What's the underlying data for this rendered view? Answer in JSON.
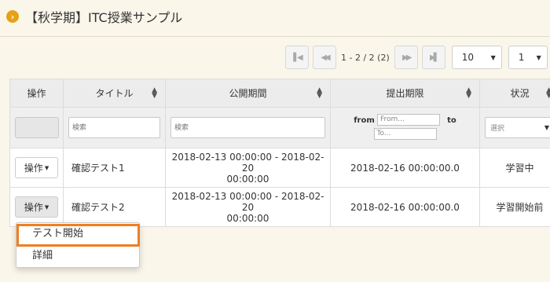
{
  "page": {
    "title": "【秋学期】ITC授業サンプル",
    "title_icon": "chevron-right-circle-icon"
  },
  "pager": {
    "info": "1 - 2 / 2 (2)",
    "per_page": "10",
    "page": "1"
  },
  "table": {
    "headers": {
      "operation": "操作",
      "title": "タイトル",
      "period": "公開期間",
      "deadline": "提出期限",
      "status": "状況"
    },
    "filters": {
      "title_placeholder": "検索",
      "period_placeholder": "検索",
      "from_label": "from",
      "from_placeholder": "From...",
      "to_label": "to",
      "to_placeholder": "To...",
      "status_placeholder": "選択"
    },
    "rows": [
      {
        "op_label": "操作",
        "title": "確認テスト1",
        "period_start": "2018-02-13 00:00:00 - 2018-02-20",
        "period_end": "00:00:00",
        "deadline": "2018-02-16 00:00:00.0",
        "status": "学習中"
      },
      {
        "op_label": "操作",
        "title": "確認テスト2",
        "period_start": "2018-02-13 00:00:00 - 2018-02-20",
        "period_end": "00:00:00",
        "deadline": "2018-02-16 00:00:00.0",
        "status": "学習開始前"
      }
    ]
  },
  "menu": {
    "items": [
      "テスト開始",
      "詳細"
    ]
  },
  "colors": {
    "background": "#faf6ea",
    "accent": "#e6a117",
    "highlight": "#f07e22"
  }
}
